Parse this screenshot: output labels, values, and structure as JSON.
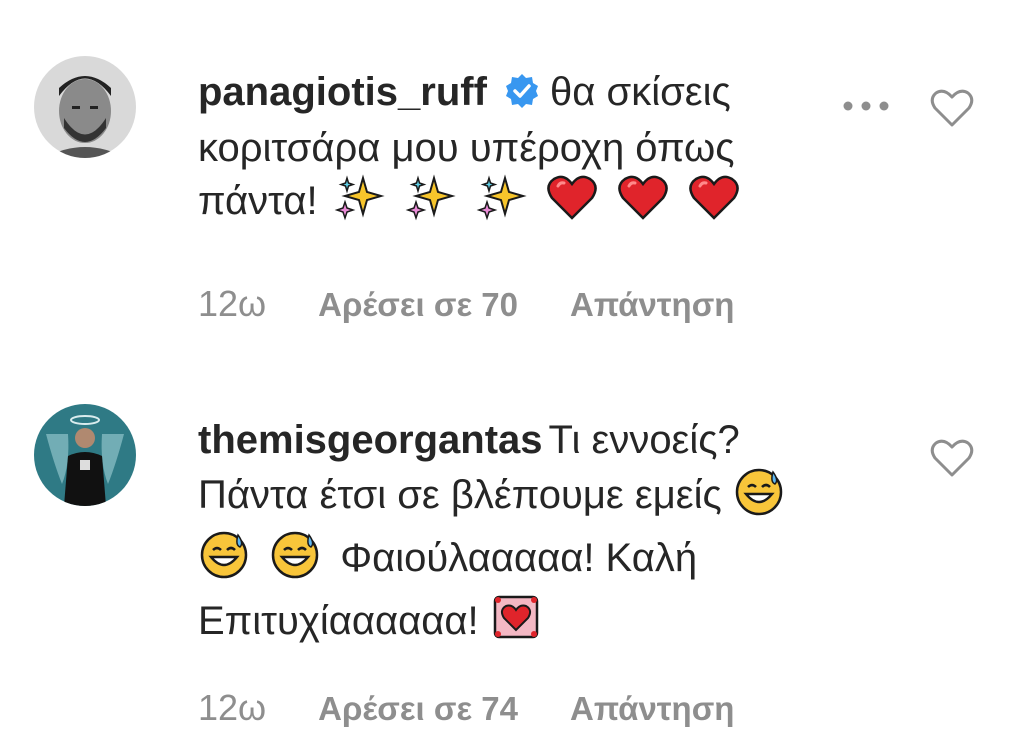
{
  "comments": [
    {
      "username": "panagiotis_ruff",
      "verified": true,
      "text_line1": "θα σκίσεις",
      "text_line2": "κοριτσάρα μου υπέροχη όπως",
      "text_line3": "πάντα!",
      "time": "12ω",
      "likes": "Αρέσει σε 70",
      "reply": "Απάντηση",
      "icons": [
        "more-options-icon",
        "heart-icon"
      ]
    },
    {
      "username": "themisgeorgantas",
      "verified": false,
      "text_line1": "Τι εννοείς?",
      "text_line2": "Πάντα έτσι σε βλέπουμε εμείς",
      "text_line3": "Φαιούλααααα! Καλή",
      "text_line4": "Επιτυχίαααααα!",
      "time": "12ω",
      "likes": "Αρέσει σε 74",
      "reply": "Απάντηση",
      "icons": [
        "heart-icon"
      ]
    }
  ],
  "colors": {
    "text": "#262626",
    "muted": "#8e8e8e",
    "verified": "#3897f0",
    "heart_red": "#e0242b",
    "sparkle": "#f7c52b"
  }
}
